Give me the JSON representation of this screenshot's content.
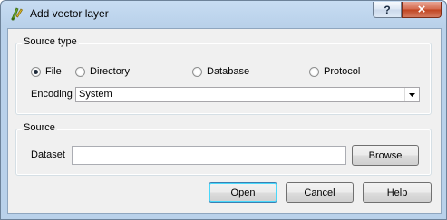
{
  "window": {
    "title": "Add vector layer",
    "help_glyph": "?",
    "close_glyph": "×"
  },
  "source_type": {
    "title": "Source type",
    "options": [
      "File",
      "Directory",
      "Database",
      "Protocol"
    ],
    "selected": "File",
    "encoding_label": "Encoding",
    "encoding_value": "System"
  },
  "source": {
    "title": "Source",
    "dataset_label": "Dataset",
    "dataset_value": "",
    "browse_label": "Browse"
  },
  "buttons": {
    "open": "Open",
    "cancel": "Cancel",
    "help": "Help"
  }
}
